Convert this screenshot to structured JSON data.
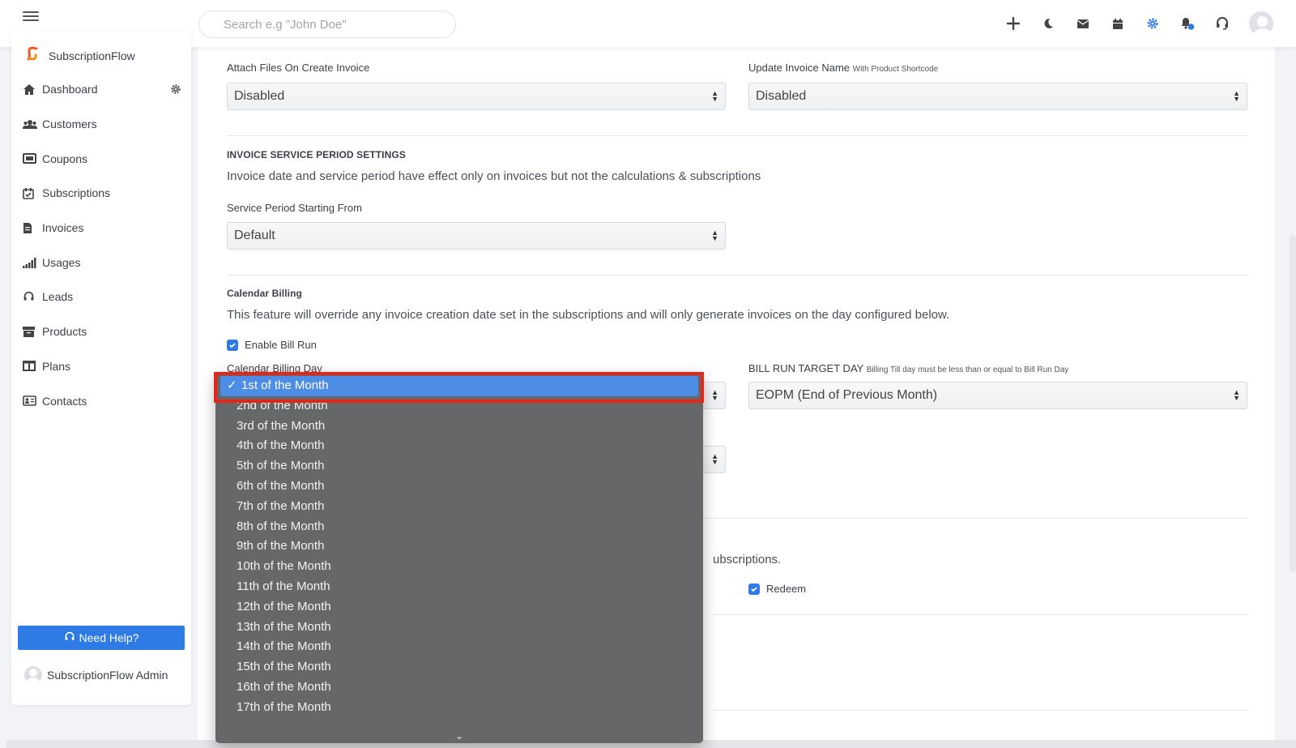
{
  "topbar": {
    "search_placeholder": "Search e.g \"John Doe\"",
    "icons": [
      "plus-icon",
      "moon-icon",
      "mail-icon",
      "calendar-icon",
      "gear-icon",
      "bell-icon",
      "headset-icon",
      "user-avatar"
    ]
  },
  "sidebar": {
    "brand": "SubscriptionFlow",
    "items": [
      {
        "label": "Dashboard",
        "icon": "home-icon"
      },
      {
        "label": "Customers",
        "icon": "users-icon"
      },
      {
        "label": "Coupons",
        "icon": "coupon-icon"
      },
      {
        "label": "Subscriptions",
        "icon": "calendar-check-icon"
      },
      {
        "label": "Invoices",
        "icon": "invoice-icon"
      },
      {
        "label": "Usages",
        "icon": "signal-icon"
      },
      {
        "label": "Leads",
        "icon": "headset-icon"
      },
      {
        "label": "Products",
        "icon": "archive-icon"
      },
      {
        "label": "Plans",
        "icon": "columns-icon"
      },
      {
        "label": "Contacts",
        "icon": "contact-card-icon"
      }
    ],
    "need_help": "Need Help?",
    "user": "SubscriptionFlow Admin"
  },
  "form": {
    "attach_files": {
      "label": "Attach Files On Create Invoice",
      "value": "Disabled"
    },
    "update_invoice_name": {
      "label": "Update Invoice Name",
      "hint": "With Product Shortcode",
      "value": "Disabled"
    },
    "service_period": {
      "title": "INVOICE SERVICE PERIOD SETTINGS",
      "description": "Invoice date and service period have effect only on invoices but not the calculations & subscriptions",
      "field_label": "Service Period Starting From",
      "value": "Default"
    },
    "calendar_billing": {
      "title": "Calendar Billing",
      "description": "This feature will override any invoice creation date set in the subscriptions and will only generate invoices on the day configured below.",
      "enable_bill_run": "Enable Bill Run",
      "day_label": "Calendar Billing Day",
      "target_day_label": "BILL RUN TARGET DAY",
      "target_day_hint": "Billing Till day must be less than or equal to Bill Run Day",
      "target_day_value": "EOPM (End of Previous Month)"
    },
    "partial_text": "ubscriptions.",
    "redeem_label": "Redeem"
  },
  "dropdown": {
    "selected_index": 0,
    "options": [
      "1st of the Month",
      "2nd of the Month",
      "3rd of the Month",
      "4th of the Month",
      "5th of the Month",
      "6th of the Month",
      "7th of the Month",
      "8th of the Month",
      "9th of the Month",
      "10th of the Month",
      "11th of the Month",
      "12th of the Month",
      "13th of the Month",
      "14th of the Month",
      "15th of the Month",
      "16th of the Month",
      "17th of the Month"
    ]
  },
  "colors": {
    "accent": "#2f7be5",
    "highlight": "#e82318",
    "dropdown_bg": "#666769",
    "selected_bg": "#4d8de6"
  }
}
